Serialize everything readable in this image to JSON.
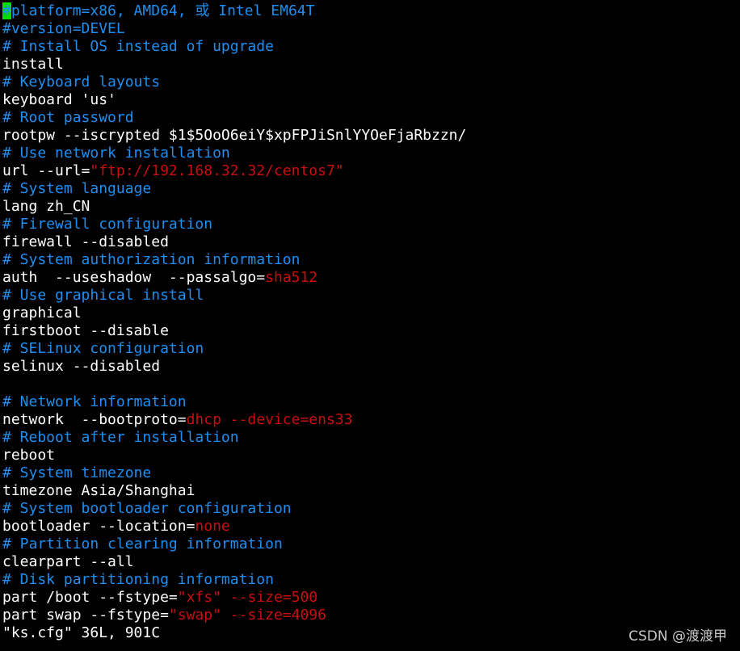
{
  "editor": {
    "lines": [
      [
        [
          "#",
          "cur"
        ],
        [
          "platform=x86, AMD64, 或 Intel EM64T",
          "c"
        ]
      ],
      [
        [
          "#version=DEVEL",
          "c"
        ]
      ],
      [
        [
          "# Install OS instead of upgrade",
          "c"
        ]
      ],
      [
        [
          "install",
          "n"
        ]
      ],
      [
        [
          "# Keyboard layouts",
          "c"
        ]
      ],
      [
        [
          "keyboard 'us'",
          "n"
        ]
      ],
      [
        [
          "# Root password",
          "c"
        ]
      ],
      [
        [
          "rootpw --iscrypted $1$5OoO6eiY$xpFPJiSnlYYOeFjaRbzzn/",
          "n"
        ]
      ],
      [
        [
          "# Use network installation",
          "c"
        ]
      ],
      [
        [
          "url --url=",
          "n"
        ],
        [
          "\"ftp://192.168.32.32/centos7\"",
          "s"
        ]
      ],
      [
        [
          "# System language",
          "c"
        ]
      ],
      [
        [
          "lang zh_CN",
          "n"
        ]
      ],
      [
        [
          "# Firewall configuration",
          "c"
        ]
      ],
      [
        [
          "firewall --disabled",
          "n"
        ]
      ],
      [
        [
          "# System authorization information",
          "c"
        ]
      ],
      [
        [
          "auth  --useshadow  --passalgo=",
          "n"
        ],
        [
          "sha512",
          "s"
        ]
      ],
      [
        [
          "# Use graphical install",
          "c"
        ]
      ],
      [
        [
          "graphical",
          "n"
        ]
      ],
      [
        [
          "firstboot --disable",
          "n"
        ]
      ],
      [
        [
          "# SELinux configuration",
          "c"
        ]
      ],
      [
        [
          "selinux --disabled",
          "n"
        ]
      ],
      [],
      [
        [
          "# Network information",
          "c"
        ]
      ],
      [
        [
          "network  --bootproto=",
          "n"
        ],
        [
          "dhcp --device=ens33",
          "s"
        ]
      ],
      [
        [
          "# Reboot after installation",
          "c"
        ]
      ],
      [
        [
          "reboot",
          "n"
        ]
      ],
      [
        [
          "# System timezone",
          "c"
        ]
      ],
      [
        [
          "timezone Asia/Shanghai",
          "n"
        ]
      ],
      [
        [
          "# System bootloader configuration",
          "c"
        ]
      ],
      [
        [
          "bootloader --location=",
          "n"
        ],
        [
          "none",
          "s"
        ]
      ],
      [
        [
          "# Partition clearing information",
          "c"
        ]
      ],
      [
        [
          "clearpart --all",
          "n"
        ]
      ],
      [
        [
          "# Disk partitioning information",
          "c"
        ]
      ],
      [
        [
          "part /boot --fstype=",
          "n"
        ],
        [
          "\"xfs\" --size=500",
          "s"
        ]
      ],
      [
        [
          "part swap --fstype=",
          "n"
        ],
        [
          "\"swap\" --size=4096",
          "s"
        ]
      ]
    ],
    "status_line": "\"ks.cfg\" 36L, 901C"
  },
  "watermark": "CSDN @渡渡甲",
  "colors": {
    "comment": "#1e8ff0",
    "string": "#c80e0e",
    "text": "#ffffff",
    "cursor": "#00e000",
    "background": "#000000"
  }
}
